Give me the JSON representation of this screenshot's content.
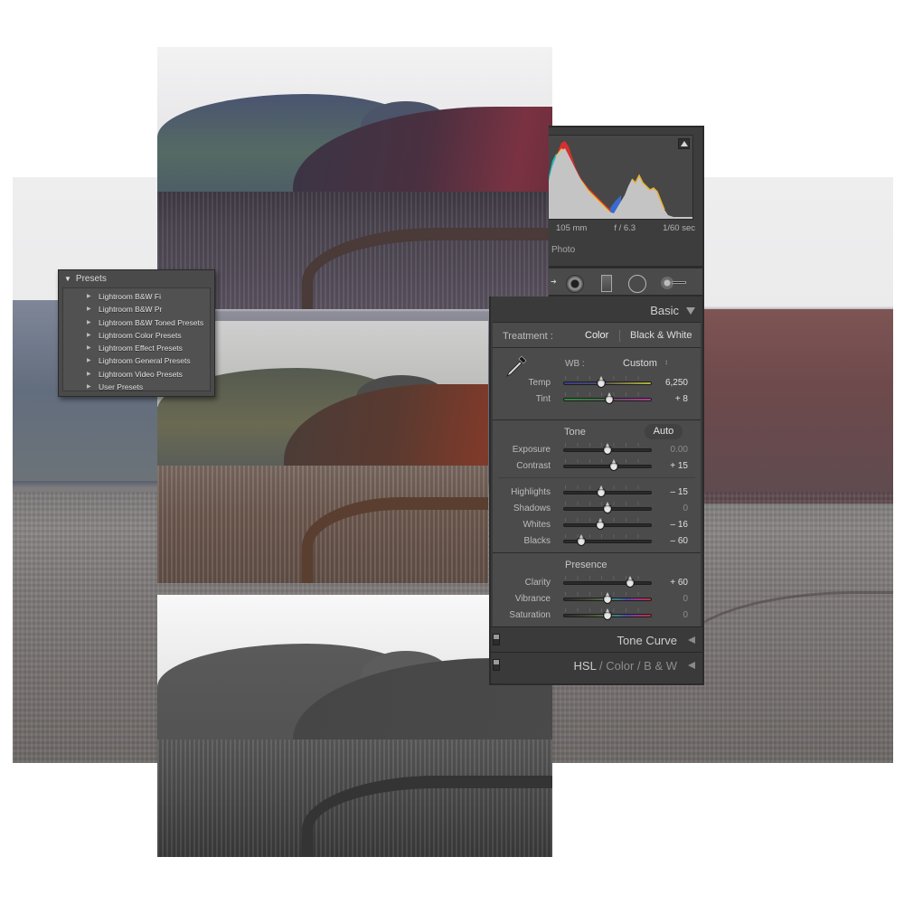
{
  "presets_panel": {
    "title": "Presets",
    "items": [
      {
        "label": "Lightroom B&W Fi"
      },
      {
        "label": "Lightroom B&W Pr"
      },
      {
        "label": "Lightroom B&W Toned Presets"
      },
      {
        "label": "Lightroom Color Presets"
      },
      {
        "label": "Lightroom Effect Presets"
      },
      {
        "label": "Lightroom General Presets"
      },
      {
        "label": "Lightroom Video Presets"
      },
      {
        "label": "User Presets"
      }
    ]
  },
  "histogram": {
    "exif": {
      "focal_length": "105 mm",
      "aperture": "f / 6.3",
      "shutter": "1/60 sec"
    },
    "label": "Photo"
  },
  "basic_panel": {
    "title": "Basic",
    "treatment": {
      "label": "Treatment :",
      "color": "Color",
      "bw": "Black & White"
    },
    "wb": {
      "label": "WB :",
      "value": "Custom",
      "caret": "↕"
    },
    "temp": {
      "label": "Temp",
      "value": "6,250",
      "position": 0.43
    },
    "tint": {
      "label": "Tint",
      "value": "+ 8",
      "position": 0.52
    },
    "tone": {
      "header": "Tone",
      "auto": "Auto",
      "sliders": [
        {
          "label": "Exposure",
          "value": "0.00",
          "position": 0.5,
          "dim": true
        },
        {
          "label": "Contrast",
          "value": "+ 15",
          "position": 0.575,
          "dim": false
        },
        {
          "label": "Highlights",
          "value": "– 15",
          "position": 0.425,
          "dim": false
        },
        {
          "label": "Shadows",
          "value": "0",
          "position": 0.5,
          "dim": true
        },
        {
          "label": "Whites",
          "value": "– 16",
          "position": 0.42,
          "dim": false
        },
        {
          "label": "Blacks",
          "value": "– 60",
          "position": 0.2,
          "dim": false
        }
      ]
    },
    "presence": {
      "header": "Presence",
      "sliders": [
        {
          "label": "Clarity",
          "value": "+ 60",
          "position": 0.76,
          "dim": false
        },
        {
          "label": "Vibrance",
          "value": "0",
          "position": 0.5,
          "dim": true
        },
        {
          "label": "Saturation",
          "value": "0",
          "position": 0.5,
          "dim": true
        }
      ]
    }
  },
  "collapsed_panels": {
    "tone_curve": "Tone Curve",
    "hsl": "HSL",
    "slash": "/",
    "color": "Color",
    "bw": "B & W"
  },
  "colors": {
    "panel_bg": "#3a3a3a",
    "section_bg": "#4b4b4b",
    "text_light": "#e0e0e0"
  }
}
